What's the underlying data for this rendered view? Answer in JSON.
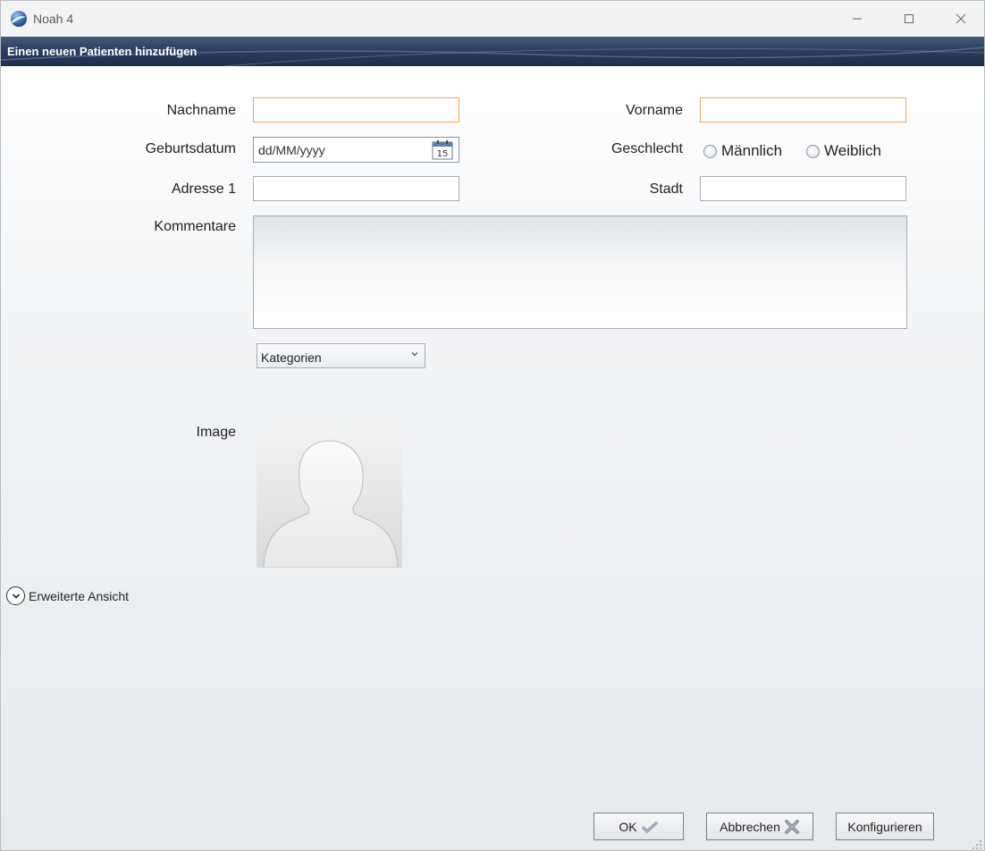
{
  "window": {
    "title": "Noah 4"
  },
  "header": {
    "title": "Einen neuen Patienten hinzufügen"
  },
  "form": {
    "lastname_label": "Nachname",
    "lastname_value": "",
    "firstname_label": "Vorname",
    "firstname_value": "",
    "birthdate_label": "Geburtsdatum",
    "birthdate_placeholder": "dd/MM/yyyy",
    "calendar_day": "15",
    "gender_label": "Geschlecht",
    "gender_options": [
      "Männlich",
      "Weiblich"
    ],
    "address_label": "Adresse 1",
    "address_value": "",
    "city_label": "Stadt",
    "city_value": "",
    "comments_label": "Kommentare",
    "comments_value": "",
    "categories_label": "Kategorien",
    "image_label": "Image"
  },
  "expand": {
    "label": "Erweiterte Ansicht"
  },
  "buttons": {
    "ok": "OK",
    "cancel": "Abbrechen",
    "configure": "Konfigurieren"
  },
  "colors": {
    "header_band": "#2d3f5e",
    "required_border": "#f3a65a",
    "field_border": "#abadb3"
  },
  "icons": {
    "app": "noah-logo-icon",
    "calendar": "calendar-icon",
    "ok": "checkmark-icon",
    "cancel": "cross-icon",
    "expand": "chevron-down-circle-icon"
  }
}
